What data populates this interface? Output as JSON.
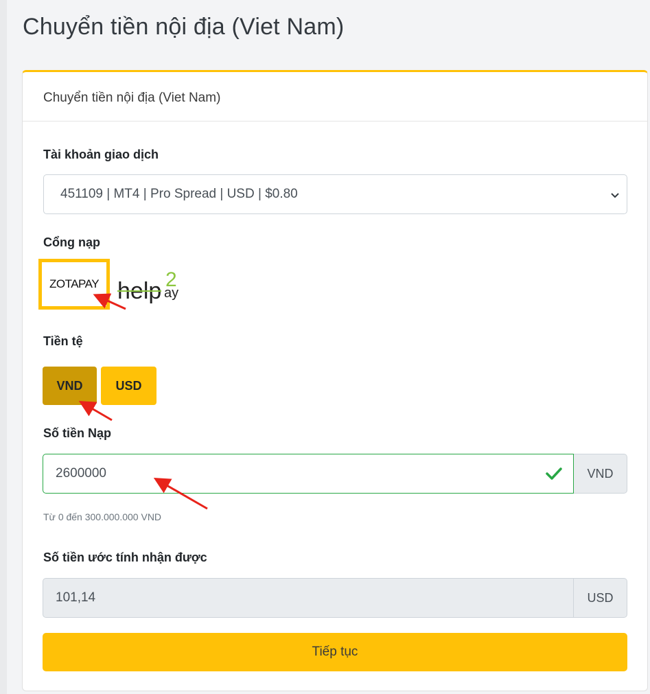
{
  "page": {
    "title": "Chuyển tiền nội địa (Viet Nam)"
  },
  "card": {
    "header": "Chuyển tiền nội địa (Viet Nam)"
  },
  "account": {
    "label": "Tài khoản giao dịch",
    "selected": "451109 | MT4 | Pro Spread | USD | $0.80"
  },
  "gateway": {
    "label": "Cổng nạp",
    "options": [
      {
        "name": "ZOTAPAY",
        "selected": true
      },
      {
        "name": "help2pay",
        "selected": false
      }
    ]
  },
  "currency": {
    "label": "Tiền tệ",
    "options": [
      "VND",
      "USD"
    ],
    "selected": "VND"
  },
  "amount": {
    "label": "Số tiền Nạp",
    "value": "2600000",
    "unit": "VND",
    "hint": "Từ 0 đến 300.000.000 VND"
  },
  "estimate": {
    "label": "Số tiền ước tính nhận được",
    "value": "101,14",
    "unit": "USD"
  },
  "submit": {
    "label": "Tiếp tục"
  },
  "colors": {
    "accent": "#ffc107",
    "accent_active": "#cc9a06",
    "valid": "#28a745",
    "annotation_arrow": "#e8231a"
  }
}
